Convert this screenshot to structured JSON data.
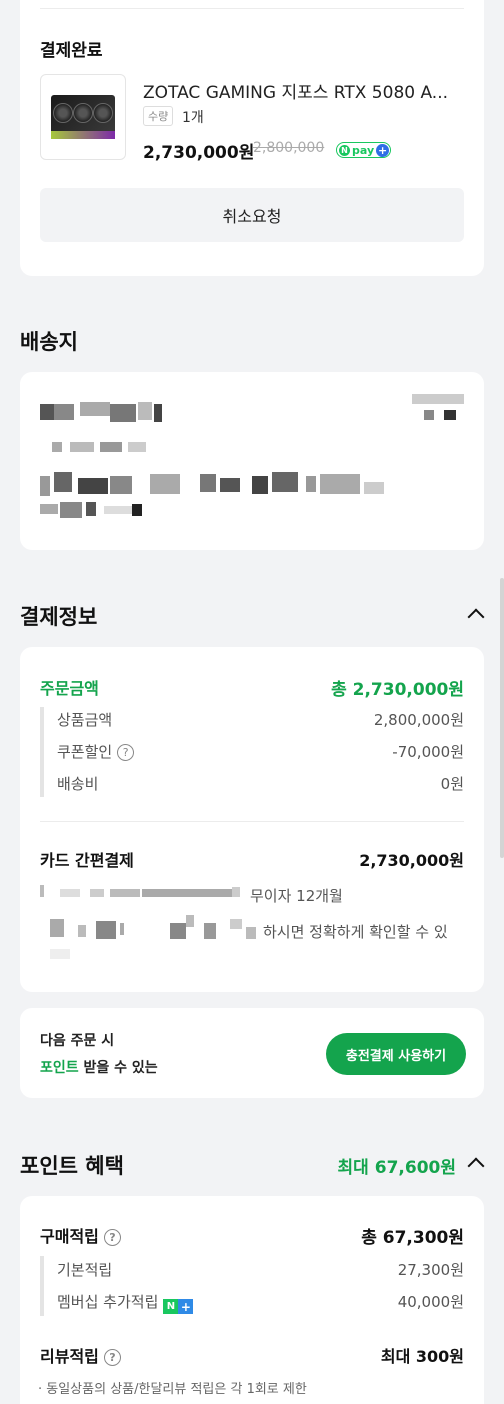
{
  "order": {
    "status": "결제완료",
    "product_name": "ZOTAC GAMING 지포스 RTX 5080 A...",
    "qty_label": "수량",
    "qty_value": "1개",
    "price": "2,730,000원",
    "original_price": "2,800,000",
    "npay_n": "N",
    "npay_text": "pay",
    "npay_plus": "+",
    "cancel_label": "취소요청"
  },
  "shipping": {
    "title": "배송지"
  },
  "payment": {
    "title": "결제정보",
    "order_amount_label": "주문금액",
    "order_amount_value": "총 2,730,000원",
    "items": [
      {
        "label": "상품금액",
        "value": "2,800,000원"
      },
      {
        "label": "쿠폰할인",
        "value": "-70,000원"
      },
      {
        "label": "배송비",
        "value": "0원"
      }
    ],
    "method_label": "카드 간편결제",
    "method_value": "2,730,000원",
    "installment": "무이자 12개월",
    "notice": "하시면 정확하게 확인할 수 있"
  },
  "prompt": {
    "line1": "다음 주문 시",
    "highlight": "포인트",
    "line2_rest": " 받을 수 있는",
    "button": "충전결제 사용하기"
  },
  "points": {
    "title": "포인트 혜택",
    "max": "최대 67,600원",
    "purchase_label": "구매적립",
    "purchase_value": "총 67,300원",
    "items": [
      {
        "label": "기본적립",
        "value": "27,300원"
      },
      {
        "label": "멤버십 추가적립",
        "value": "40,000원"
      }
    ],
    "membership_badge_n": "N",
    "membership_badge_plus": "+",
    "review_label": "리뷰적립",
    "review_value": "최대 300원",
    "review_note": "· 동일상품의 상품/한달리뷰 적립은 각 1회로 제한"
  },
  "icons": {
    "help": "?"
  },
  "colors": {
    "accent_green": "#14a44d",
    "npay_green": "#19c75f",
    "npay_blue": "#2f6fe6"
  }
}
